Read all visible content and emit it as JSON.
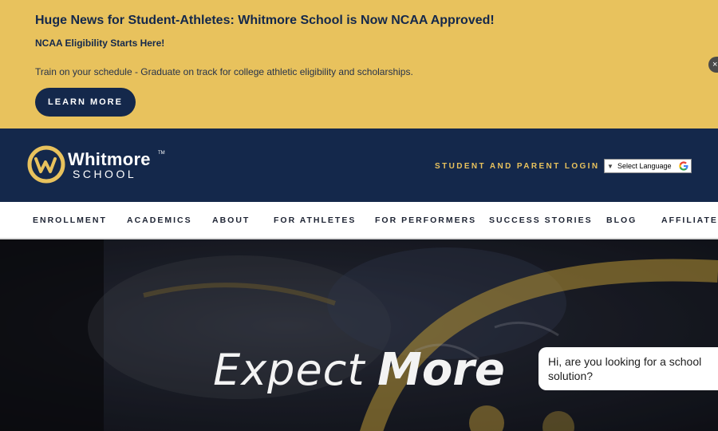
{
  "banner": {
    "headline": "Huge News for Student-Athletes: Whitmore School is Now NCAA Approved!",
    "subheadline": "NCAA Eligibility Starts Here!",
    "body": "Train on your schedule - Graduate on track for college athletic eligibility and scholarships.",
    "cta_label": "LEARN MORE",
    "close_glyph": "×"
  },
  "header": {
    "logo_name": "Whitmore",
    "logo_tm": "TM",
    "logo_school": "SCHOOL",
    "login_label": "STUDENT AND PARENT LOGIN",
    "language": {
      "arrow": "▼",
      "selected": "Select Language",
      "icon": "google-icon"
    }
  },
  "nav": {
    "items": [
      {
        "label": "ENROLLMENT"
      },
      {
        "label": "ACADEMICS"
      },
      {
        "label": "ABOUT"
      },
      {
        "label": "FOR ATHLETES"
      },
      {
        "label": "FOR PERFORMERS"
      },
      {
        "label": "SUCCESS STORIES"
      },
      {
        "label": "BLOG"
      },
      {
        "label": "AFFILIATES"
      }
    ]
  },
  "hero": {
    "title_light": "Expect",
    "title_bold": "More"
  },
  "chat": {
    "message": "Hi, are you looking for a school solution?"
  },
  "colors": {
    "banner_bg": "#e8c25d",
    "navy": "#14284b",
    "gold": "#e8c25d",
    "white": "#ffffff"
  }
}
